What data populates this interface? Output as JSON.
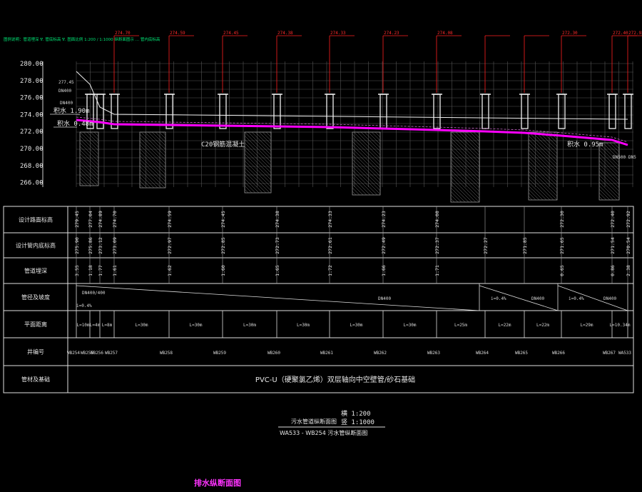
{
  "drawing": {
    "header_note": "图例说明：管道埋深 ∇. 管底标高 ∇. 图面比例 1:200 / 1:1000 纵断面图示 … 管内底标高",
    "y_axis_ticks": [
      "280.00",
      "278.00",
      "276.00",
      "274.00",
      "272.00",
      "270.00",
      "268.00",
      "266.00"
    ],
    "row_labels": [
      "设计路面标高",
      "设计管内底标高",
      "管道埋深",
      "管径及坡度",
      "平面距离",
      "井编号",
      "管材及基础"
    ],
    "manholes": [
      {
        "id": "WB254",
        "ground": "279.45",
        "invert": "275.90",
        "depth": "3.55"
      },
      {
        "id": "WB255",
        "ground": "277.04",
        "invert": "275.86",
        "depth": "1.18"
      },
      {
        "id": "WB256",
        "ground": "274.89",
        "invert": "273.12",
        "depth": "1.77"
      },
      {
        "id": "WB257",
        "ground": "274.70",
        "invert": "273.09",
        "depth": "1.61"
      },
      {
        "id": "WB258",
        "ground": "274.59",
        "invert": "272.97",
        "depth": "1.62"
      },
      {
        "id": "WB259",
        "ground": "274.45",
        "invert": "272.85",
        "depth": "1.60"
      },
      {
        "id": "WB260",
        "ground": "274.38",
        "invert": "272.73",
        "depth": "1.65"
      },
      {
        "id": "WB261",
        "ground": "274.33",
        "invert": "272.61",
        "depth": "1.72"
      },
      {
        "id": "WB262",
        "ground": "274.23",
        "invert": "272.49",
        "depth": "1.66"
      },
      {
        "id": "WB263",
        "ground": "274.08",
        "invert": "272.37",
        "depth": "1.71"
      },
      {
        "id": "WB264",
        "ground": "",
        "invert": "272.27",
        "depth": ""
      },
      {
        "id": "WB265",
        "ground": "",
        "invert": "271.85",
        "depth": ""
      },
      {
        "id": "WB266",
        "ground": "272.30",
        "invert": "271.65",
        "depth": "0.65"
      },
      {
        "id": "WB267",
        "ground": "272.40",
        "invert": "271.54",
        "depth": "0.86"
      },
      {
        "id": "WA533",
        "ground": "272.92",
        "invert": "270.54",
        "depth": "2.38"
      }
    ],
    "distances": [
      "L=10m",
      "L=4m",
      "L=8m",
      "L=30m",
      "L=30m",
      "L=30m",
      "L=30m",
      "L=30m",
      "L=30m",
      "L=25m",
      "L=22m",
      "L=22m",
      "L=29m",
      "L=10.34m"
    ],
    "pipe_segments": [
      {
        "size": "DN400/400",
        "slope": "i=0.4%"
      },
      {
        "size": "DN400",
        "slope": "i=0.4%"
      },
      {
        "size": "DN400",
        "slope": "i=0.4%"
      },
      {
        "size": "DN400",
        "slope": "i=0.4%"
      }
    ],
    "material": "PVC-U（硬聚氯乙烯）双层轴向中空壁管/砂石基础",
    "annotations": {
      "water_level_1": "积水 1.90m",
      "water_level_2": "积水 0.48m",
      "water_level_3": "积水 0.95m",
      "c20": "C20钢筋混凝土",
      "top_left_elev": "277.45",
      "dn_label_1": "DN400",
      "dn_label_2": "DN400",
      "dn_label_3": "DN500",
      "dn_label_4": "DN5"
    },
    "title_block": {
      "name": "污水管道纵断面图",
      "scale_h_label": "横",
      "scale_h": "1:200",
      "scale_v_label": "竖",
      "scale_v": "1:1000",
      "subtitle": "WA533 - WB254 污水管纵断面图"
    },
    "bottom_title": "排水纵断面图",
    "colors": {
      "pipe": "#ff00ff",
      "grid": "#6d6d6d",
      "red": "#ff2020",
      "text": "#e6e6e6",
      "magenta_text": "#ff33ff"
    }
  }
}
